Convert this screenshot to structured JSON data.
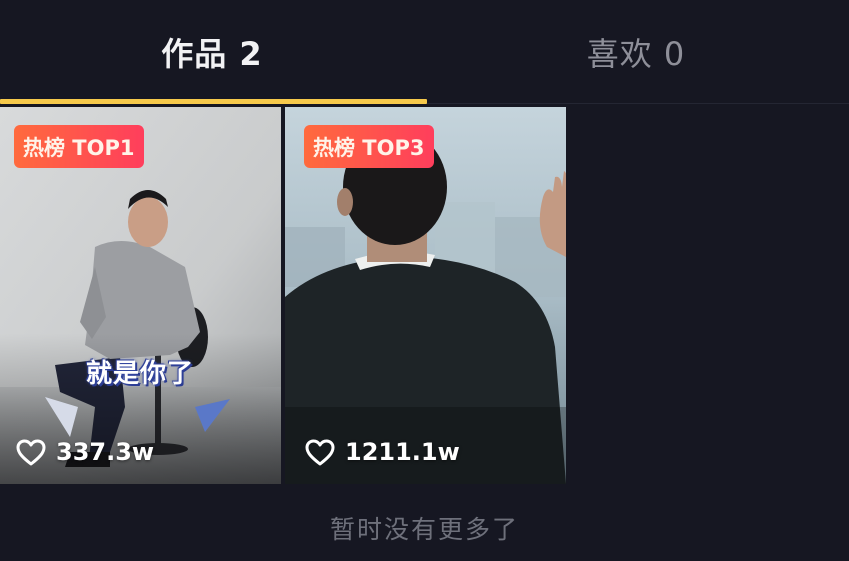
{
  "tabs": [
    {
      "label": "作品 2",
      "active": true
    },
    {
      "label": "喜欢 0",
      "active": false
    }
  ],
  "accent_color": "#f6c94b",
  "videos": [
    {
      "badge": "热榜 TOP1",
      "caption": "就是你了",
      "likes": "337.3w",
      "icon": "heart-outline-icon"
    },
    {
      "badge": "热榜 TOP3",
      "likes": "1211.1w",
      "icon": "heart-outline-icon"
    }
  ],
  "footer": {
    "text": "暂时没有更多了"
  }
}
